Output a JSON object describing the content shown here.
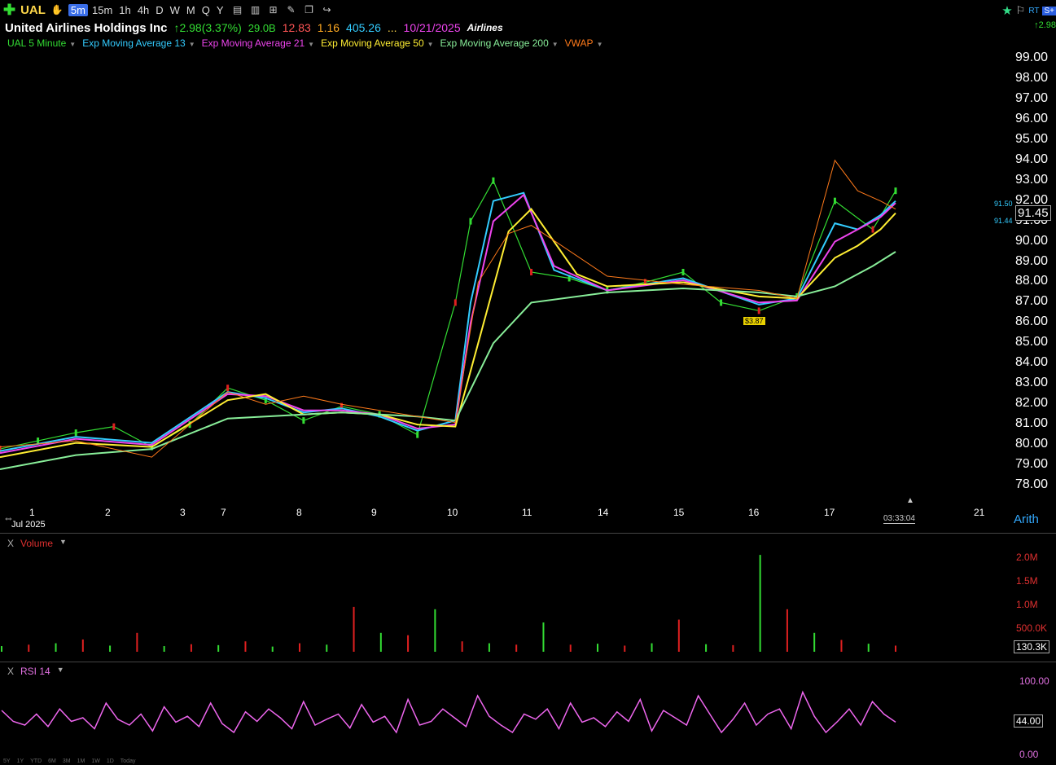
{
  "toolbar": {
    "symbol": "UAL",
    "timeframes": [
      "5m",
      "15m",
      "1h",
      "4h",
      "D",
      "W",
      "M",
      "Q",
      "Y"
    ],
    "active_timeframe": "5m",
    "right_badges": [
      "RT",
      "S+"
    ],
    "right_change": "2.98"
  },
  "header": {
    "company": "United Airlines Holdings Inc",
    "change": "2.98(3.37%)",
    "market_cap": "29.0B",
    "pe": "12.83",
    "beta": "1.16",
    "fourth_value": "405.26",
    "ellipsis": "...",
    "date": "10/21/2025",
    "industry": "Airlines"
  },
  "legend": [
    {
      "label": "UAL 5 Minute",
      "color": "#33dd33"
    },
    {
      "label": "Exp Moving Average 13",
      "color": "#33ccff"
    },
    {
      "label": "Exp Moving Average 21",
      "color": "#ee44ee"
    },
    {
      "label": "Exp Moving Average 50",
      "color": "#ffee33"
    },
    {
      "label": "Exp Moving Average 200",
      "color": "#88ee99"
    },
    {
      "label": "VWAP",
      "color": "#ff7a1a"
    }
  ],
  "price_panel": {
    "last_price": "91.45",
    "small_labels": [
      "91.50",
      "91.44"
    ],
    "marker": "$3.87",
    "scale": "Arith",
    "timer": "03:33:04",
    "month_label": "Jul 2025"
  },
  "volume_panel": {
    "title": "Volume",
    "close_label": "X",
    "current": "130.3K"
  },
  "rsi_panel": {
    "title": "RSI 14",
    "close_label": "X",
    "current": "44.00"
  },
  "bottom_ranges": [
    "5Y",
    "1Y",
    "YTD",
    "6M",
    "3M",
    "1M",
    "1W",
    "1D",
    "Today"
  ],
  "chart_data": [
    {
      "type": "line",
      "title": "UAL 5 Minute",
      "y_ticks": [
        "99.00",
        "98.00",
        "97.00",
        "96.00",
        "95.00",
        "94.00",
        "93.00",
        "92.00",
        "91.00",
        "90.00",
        "89.00",
        "88.00",
        "87.00",
        "86.00",
        "85.00",
        "84.00",
        "83.00",
        "82.00",
        "81.00",
        "80.00",
        "79.00",
        "78.00"
      ],
      "ylim": [
        78,
        99
      ],
      "x_ticks": [
        "1",
        "2",
        "3",
        "7",
        "8",
        "9",
        "10",
        "11",
        "14",
        "15",
        "16",
        "17",
        "21"
      ],
      "series": [
        {
          "name": "UAL 5 Minute",
          "color": "#33dd33",
          "x": [
            0,
            0.5,
            1,
            1.5,
            2,
            2.5,
            3,
            3.5,
            4,
            4.5,
            5,
            5.5,
            6,
            6.2,
            6.5,
            7,
            7.5,
            8,
            8.5,
            9,
            9.5,
            10,
            10.5,
            11,
            11.5,
            11.8
          ],
          "values": [
            79.8,
            80.2,
            80.6,
            80.9,
            79.9,
            81.0,
            82.8,
            82.2,
            81.2,
            81.9,
            81.5,
            80.5,
            87.0,
            91.0,
            93.0,
            88.5,
            88.2,
            87.6,
            88.0,
            88.5,
            87.0,
            86.6,
            87.3,
            92.0,
            90.6,
            92.5
          ]
        },
        {
          "name": "Exp Moving Average 13",
          "color": "#33ccff",
          "x": [
            0,
            1,
            2,
            3,
            3.5,
            4,
            4.5,
            5,
            5.5,
            6,
            6.2,
            6.5,
            6.9,
            7.3,
            8,
            9,
            10,
            10.5,
            11,
            11.3,
            11.6,
            11.8
          ],
          "values": [
            79.7,
            80.4,
            80.1,
            82.6,
            82.3,
            81.6,
            81.8,
            81.4,
            80.7,
            81.2,
            87.0,
            92.0,
            92.4,
            88.6,
            87.6,
            88.2,
            86.9,
            87.2,
            90.9,
            90.6,
            91.3,
            92.0
          ]
        },
        {
          "name": "Exp Moving Average 21",
          "color": "#ee44ee",
          "x": [
            0,
            1,
            2,
            3,
            3.5,
            4,
            4.5,
            5,
            5.5,
            6,
            6.2,
            6.5,
            6.9,
            7.3,
            8,
            9,
            10,
            10.5,
            11,
            11.3,
            11.6,
            11.8
          ],
          "values": [
            79.6,
            80.3,
            80.0,
            82.5,
            82.4,
            81.7,
            81.7,
            81.5,
            80.8,
            81.0,
            86.0,
            91.0,
            92.3,
            88.8,
            87.6,
            88.1,
            87.0,
            87.1,
            90.0,
            90.6,
            91.2,
            91.9
          ]
        },
        {
          "name": "Exp Moving Average 50",
          "color": "#ffee33",
          "x": [
            0,
            1,
            2,
            3,
            3.5,
            4,
            4.5,
            5,
            5.5,
            6,
            6.3,
            6.7,
            7.0,
            7.6,
            8,
            9,
            10,
            10.5,
            11,
            11.3,
            11.6,
            11.8
          ],
          "values": [
            79.4,
            80.1,
            79.9,
            82.2,
            82.5,
            81.5,
            81.6,
            81.5,
            81.0,
            80.9,
            85.0,
            90.5,
            91.6,
            88.4,
            87.8,
            88.0,
            87.3,
            87.2,
            89.2,
            89.8,
            90.6,
            91.4
          ]
        },
        {
          "name": "Exp Moving Average 200",
          "color": "#88ee99",
          "x": [
            0,
            1,
            2,
            3,
            3.5,
            4,
            4.5,
            5,
            5.5,
            6,
            6.5,
            7,
            8,
            9,
            10,
            10.5,
            11,
            11.5,
            11.8
          ],
          "values": [
            78.8,
            79.5,
            79.8,
            81.3,
            81.4,
            81.5,
            81.6,
            81.5,
            81.4,
            81.2,
            85.0,
            87.0,
            87.5,
            87.7,
            87.5,
            87.3,
            87.8,
            88.8,
            89.5
          ]
        },
        {
          "name": "VWAP",
          "color": "#ff7a1a",
          "x": [
            0,
            1,
            2,
            3,
            3.5,
            4,
            4.5,
            5,
            5.5,
            6,
            6.3,
            6.7,
            7.0,
            8,
            9,
            10,
            10.5,
            11,
            11.3,
            11.6,
            11.8
          ],
          "values": [
            79.9,
            80.2,
            79.4,
            82.6,
            82.0,
            82.4,
            82.0,
            81.7,
            81.4,
            81.1,
            88.0,
            90.4,
            90.8,
            88.3,
            87.9,
            87.6,
            87.2,
            94.0,
            92.5,
            92.0,
            91.6
          ]
        }
      ]
    },
    {
      "type": "bar",
      "title": "Volume",
      "y_ticks": [
        "2.0M",
        "1.5M",
        "1.0M",
        "500.0K"
      ],
      "ylim": [
        0,
        2000000
      ],
      "values": [
        120000,
        150000,
        180000,
        260000,
        130000,
        400000,
        120000,
        160000,
        140000,
        220000,
        110000,
        180000,
        150000,
        950000,
        400000,
        350000,
        900000,
        220000,
        180000,
        150000,
        620000,
        150000,
        170000,
        130000,
        180000,
        680000,
        160000,
        140000,
        2050000,
        900000,
        400000,
        250000,
        170000,
        130000
      ]
    },
    {
      "type": "line",
      "title": "RSI 14",
      "y_ticks": [
        "100.00",
        "0.00"
      ],
      "ylim": [
        0,
        100
      ],
      "values": [
        60,
        45,
        40,
        55,
        38,
        62,
        45,
        50,
        35,
        70,
        48,
        40,
        55,
        32,
        65,
        44,
        52,
        38,
        70,
        42,
        30,
        58,
        45,
        62,
        50,
        35,
        72,
        40,
        48,
        55,
        36,
        68,
        44,
        52,
        30,
        75,
        40,
        45,
        62,
        50,
        38,
        80,
        52,
        40,
        30,
        55,
        48,
        62,
        35,
        70,
        44,
        50,
        38,
        58,
        45,
        75,
        32,
        60,
        50,
        40,
        80,
        55,
        30,
        48,
        70,
        40,
        55,
        62,
        35,
        85,
        52,
        30,
        45,
        62,
        40,
        72,
        55,
        44
      ]
    }
  ]
}
